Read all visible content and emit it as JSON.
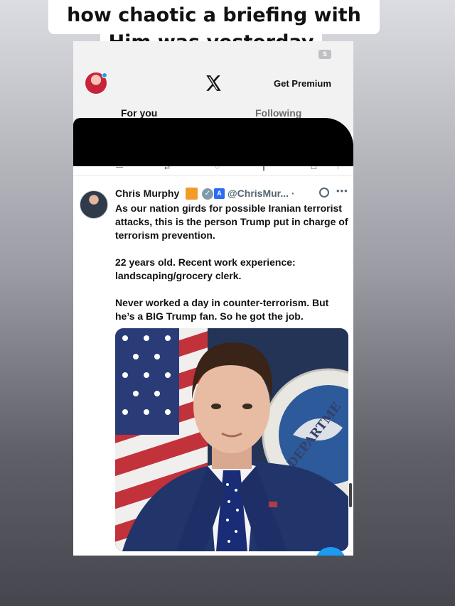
{
  "caption": {
    "line1": "how chaotic a briefing with",
    "line2": "Him was yesterday"
  },
  "topbar": {
    "grok_badge": "S",
    "premium_label": "Get Premium",
    "tabs": [
      {
        "label": "For you",
        "active": true
      },
      {
        "label": "Following",
        "active": false
      }
    ]
  },
  "tweet": {
    "author_name": "Chris Murphy",
    "handle": "@ChrisMur... ·",
    "paragraphs": [
      "As our nation girds for possible Iranian terrorist attacks, this is the person Trump put in charge of terrorism prevention.",
      "22 years old. Recent work experience: landscaping/grocery clerk.",
      "Never worked a day in counter-terrorism. But he’s a BIG Trump fan. So he got the job."
    ],
    "photo_seal_text": "DEPARTME"
  },
  "colors": {
    "accent": "#1d9bf0",
    "verified_badge": "#829aab",
    "affiliate_badge": "#2c6bf6",
    "flag_square": "#f39b28",
    "redaction": "#000000"
  },
  "icons": {
    "logo": "x-logo-icon",
    "verified": "verified-badge-icon",
    "grok": "grok-icon",
    "more": "more-icon"
  }
}
